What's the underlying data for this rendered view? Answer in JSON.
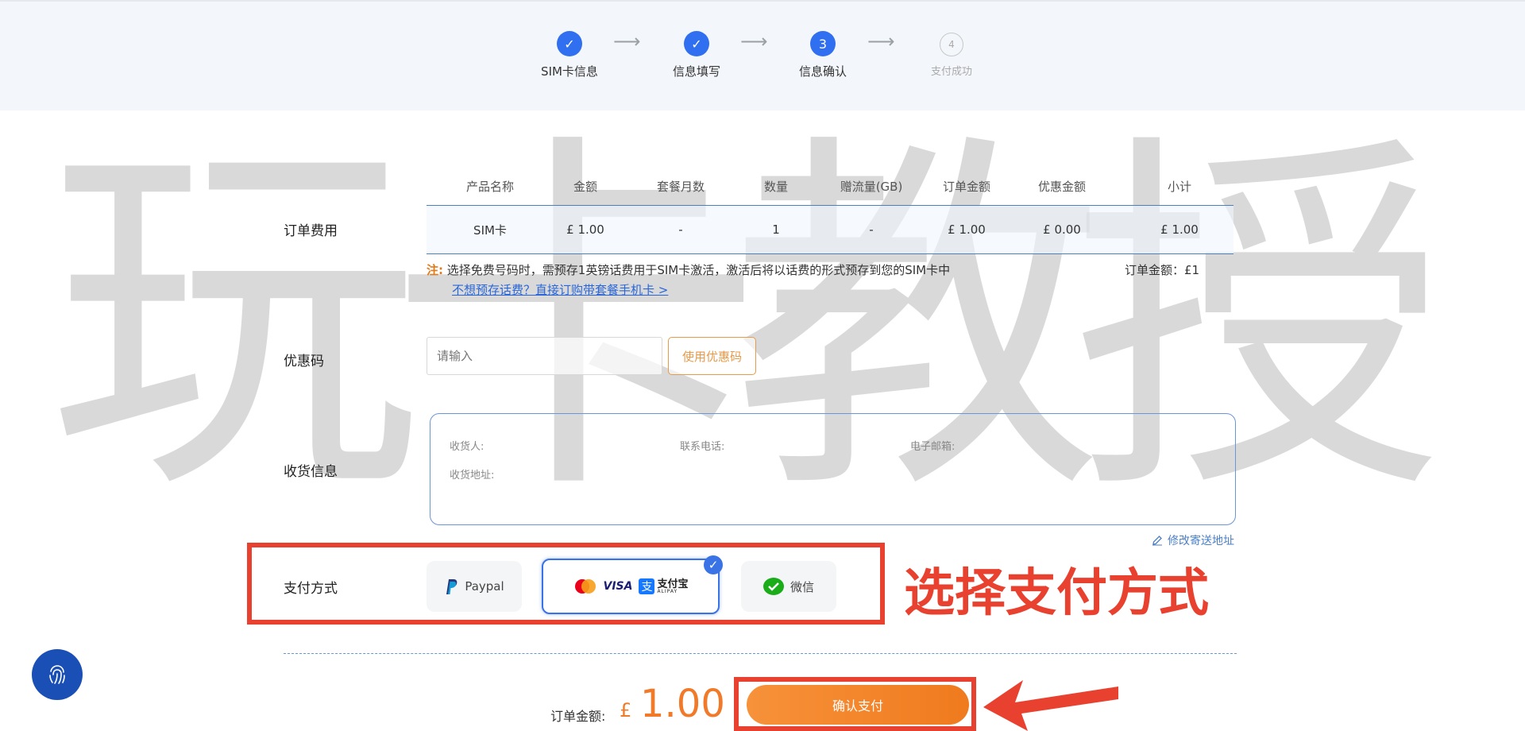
{
  "steps": [
    {
      "label": "SIM卡信息",
      "state": "done",
      "mark": "✓"
    },
    {
      "label": "信息填写",
      "state": "done",
      "mark": "✓"
    },
    {
      "label": "信息确认",
      "state": "active",
      "mark": "3"
    },
    {
      "label": "支付成功",
      "state": "pending",
      "mark": "4"
    }
  ],
  "watermark": "玩卡教授",
  "order": {
    "section_label": "订单费用",
    "headers": [
      "产品名称",
      "金额",
      "套餐月数",
      "数量",
      "赠流量(GB)",
      "订单金额",
      "优惠金额",
      "小计"
    ],
    "row": [
      "SIM卡",
      "£ 1.00",
      "-",
      "1",
      "-",
      "£ 1.00",
      "£ 0.00",
      "£ 1.00"
    ],
    "note_tag": "注:",
    "note_text": "选择免费号码时，需预存1英镑话费用于SIM卡激活，激活后将以话费的形式预存到您的SIM卡中",
    "link_text": "不想预存话费？直接订购带套餐手机卡 >",
    "total_small": "订单金额：£1"
  },
  "coupon": {
    "section_label": "优惠码",
    "placeholder": "请输入",
    "button_label": "使用优惠码"
  },
  "shipping": {
    "section_label": "收货信息",
    "recipient_label": "收货人:",
    "phone_label": "联系电话:",
    "email_label": "电子邮箱:",
    "address_label": "收货地址:",
    "edit_label": "修改寄送地址"
  },
  "payment": {
    "section_label": "支付方式",
    "options": [
      {
        "label": "Paypal",
        "selected": false
      },
      {
        "label": "VISA",
        "selected": true
      },
      {
        "label": "微信",
        "selected": false
      }
    ],
    "alipay_text": "支付宝",
    "alipay_sub": "ALIPAY",
    "callout": "选择支付方式"
  },
  "summary": {
    "label": "订单金额:",
    "currency": "£",
    "amount": "1.00",
    "confirm_label": "确认支付"
  },
  "colors": {
    "primary": "#2f6ff0",
    "accent_orange": "#f07a2a",
    "annotation_red": "#e9412f"
  }
}
